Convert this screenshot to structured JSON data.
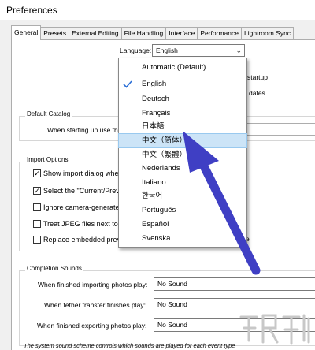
{
  "window": {
    "title": "Preferences"
  },
  "tabs": [
    "General",
    "Presets",
    "External Editing",
    "File Handling",
    "Interface",
    "Performance",
    "Lightroom Sync"
  ],
  "language": {
    "label": "Language:",
    "selected": "English",
    "options": [
      {
        "label": "Automatic (Default)",
        "checked": false,
        "highlighted": false
      },
      {
        "label": "English",
        "checked": true,
        "highlighted": false
      },
      {
        "label": "Deutsch",
        "checked": false,
        "highlighted": false
      },
      {
        "label": "Français",
        "checked": false,
        "highlighted": false
      },
      {
        "label": "日本語",
        "checked": false,
        "highlighted": false
      },
      {
        "label": "中文（简体）",
        "checked": false,
        "highlighted": true
      },
      {
        "label": "中文（繁體）",
        "checked": false,
        "highlighted": false
      },
      {
        "label": "Nederlands",
        "checked": false,
        "highlighted": false
      },
      {
        "label": "Italiano",
        "checked": false,
        "highlighted": false
      },
      {
        "label": "한국어",
        "checked": false,
        "highlighted": false
      },
      {
        "label": "Português",
        "checked": false,
        "highlighted": false
      },
      {
        "label": "Español",
        "checked": false,
        "highlighted": false
      },
      {
        "label": "Svenska",
        "checked": false,
        "highlighted": false
      }
    ]
  },
  "behind": {
    "startup_fragment": "startup",
    "updates_fragment": "dates",
    "default_catalog_title": "Default Catalog",
    "catalog_label": "When starting up use th",
    "import_options_title": "Import Options",
    "e_fragment": "e"
  },
  "import_options": [
    {
      "label": "Show import dialog when",
      "checked": true
    },
    {
      "label": "Select the \"Current/Previ",
      "checked": true
    },
    {
      "label": "Ignore camera-generated",
      "checked": false
    },
    {
      "label": "Treat JPEG files next to r",
      "checked": false
    },
    {
      "label": "Replace embedded previe",
      "checked": false
    }
  ],
  "completion_sounds": {
    "title": "Completion Sounds",
    "rows": [
      {
        "label": "When finished importing photos play:",
        "value": "No Sound"
      },
      {
        "label": "When tether transfer finishes play:",
        "value": "No Sound"
      },
      {
        "label": "When finished exporting photos play:",
        "value": "No Sound"
      }
    ],
    "note": "The system sound scheme controls which sounds are played for each event type"
  },
  "colors": {
    "highlight": "#cce4f7",
    "arrow": "#3f3fc4"
  },
  "icons": [
    "checkmark-icon",
    "chevron-down-icon",
    "arrow-pointer-annotation",
    "watermark-logo"
  ]
}
